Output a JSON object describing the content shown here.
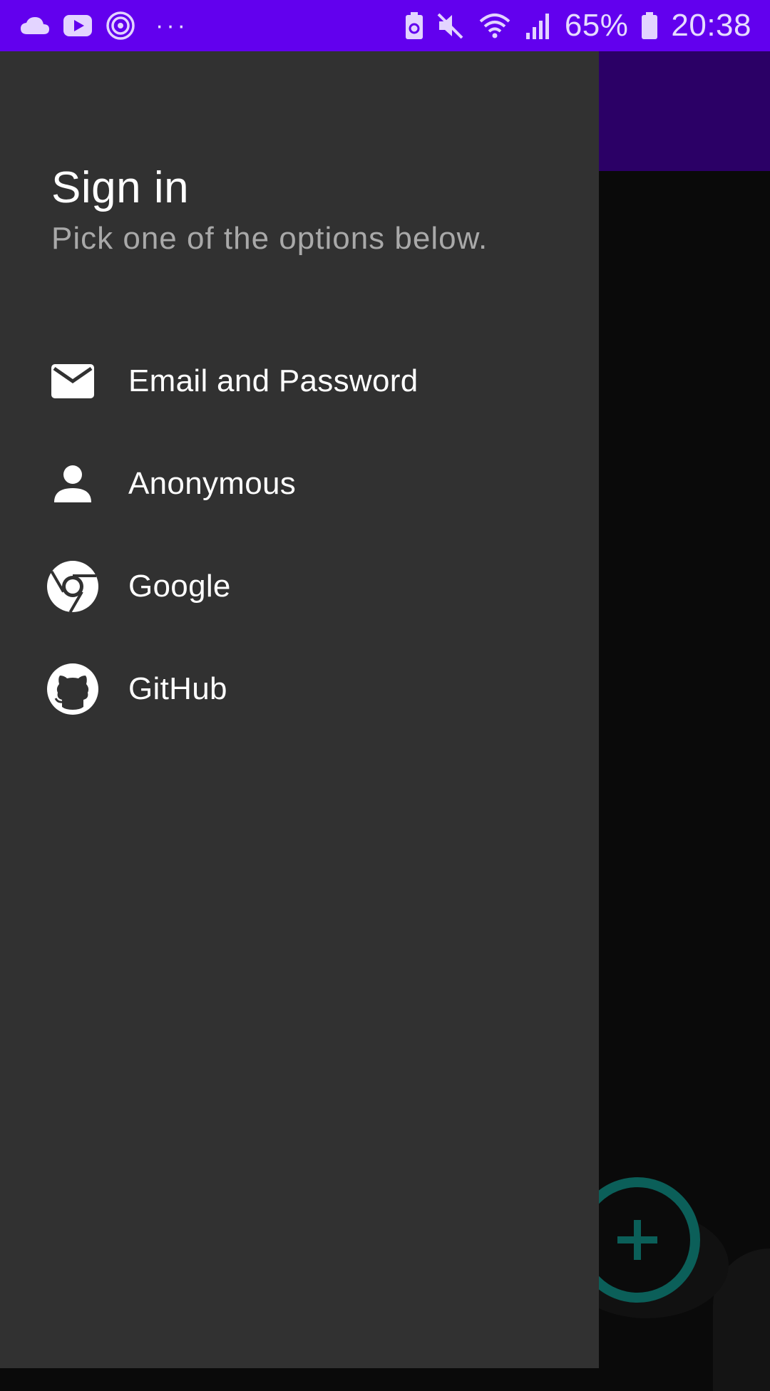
{
  "status_bar": {
    "battery_percent": "65%",
    "time": "20:38",
    "left_icons": [
      "cloud-icon",
      "youtube-icon",
      "hotspot-icon",
      "more-dots-icon"
    ],
    "right_icons": [
      "battery-saver-icon",
      "mute-icon",
      "wifi-icon",
      "signal-icon",
      "battery-icon"
    ],
    "colors": {
      "background": "#6200ee"
    }
  },
  "drawer": {
    "title": "Sign in",
    "subtitle": "Pick one of the options below.",
    "options": [
      {
        "label": "Email and Password",
        "icon": "email-icon"
      },
      {
        "label": "Anonymous",
        "icon": "person-icon"
      },
      {
        "label": "Google",
        "icon": "chrome-icon"
      },
      {
        "label": "GitHub",
        "icon": "github-icon"
      }
    ],
    "colors": {
      "background": "#313131",
      "text": "#ffffff",
      "subtext": "#a9a9a9"
    }
  },
  "background_app": {
    "fab_icon": "plus-icon",
    "colors": {
      "app_bar": "#2b0066",
      "fab_accent": "#0b5f59"
    }
  }
}
